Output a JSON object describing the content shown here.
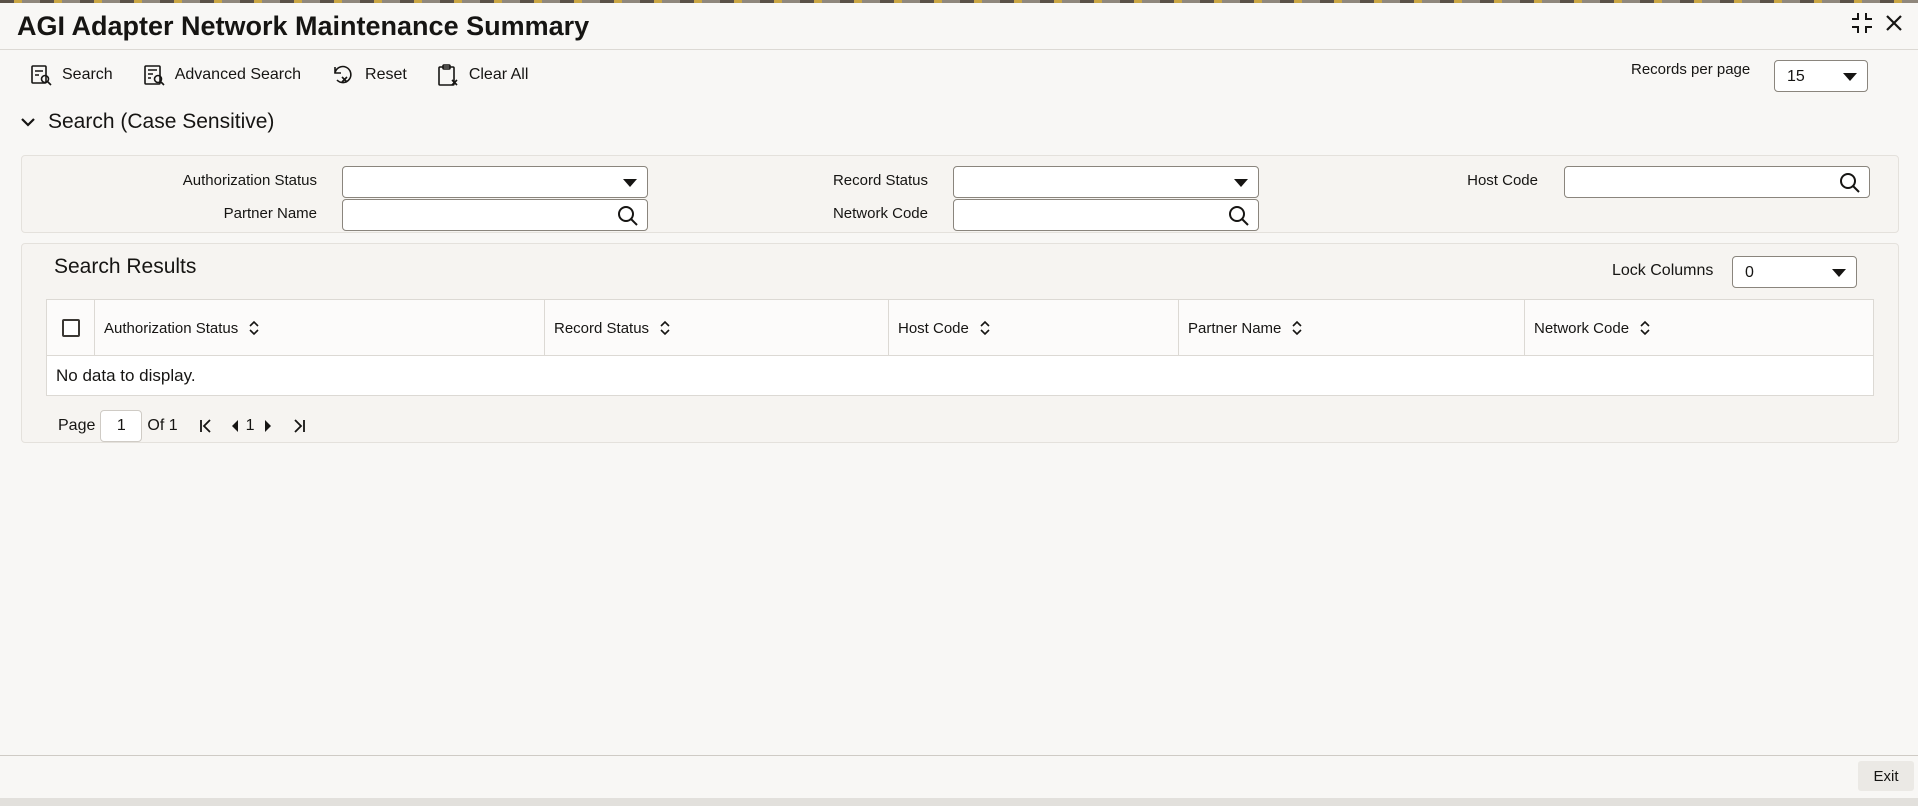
{
  "window": {
    "title": "AGI Adapter Network Maintenance Summary"
  },
  "toolbar": {
    "search_label": "Search",
    "advanced_search_label": "Advanced Search",
    "reset_label": "Reset",
    "clear_all_label": "Clear All",
    "records_per_page_label": "Records per page",
    "records_per_page_value": "15"
  },
  "search_section": {
    "title": "Search (Case Sensitive)",
    "fields": {
      "authorization_status": {
        "label": "Authorization Status",
        "value": ""
      },
      "record_status": {
        "label": "Record Status",
        "value": ""
      },
      "host_code": {
        "label": "Host Code",
        "value": ""
      },
      "partner_name": {
        "label": "Partner Name",
        "value": ""
      },
      "network_code": {
        "label": "Network Code",
        "value": ""
      }
    }
  },
  "results": {
    "title": "Search Results",
    "lock_columns_label": "Lock Columns",
    "lock_columns_value": "0",
    "columns": [
      "Authorization Status",
      "Record Status",
      "Host Code",
      "Partner Name",
      "Network Code"
    ],
    "empty_message": "No data to display."
  },
  "pager": {
    "page_label": "Page",
    "current_page": "1",
    "of_label": "Of 1",
    "page_link": "1"
  },
  "footer": {
    "exit_label": "Exit"
  },
  "icons": [
    "minimize-icon",
    "close-icon",
    "search-icon",
    "advanced-search-icon",
    "reset-icon",
    "clear-all-icon",
    "chevron-down-icon",
    "magnifier-icon",
    "sort-icon",
    "first-page-icon",
    "prev-page-icon",
    "next-page-icon",
    "last-page-icon"
  ]
}
